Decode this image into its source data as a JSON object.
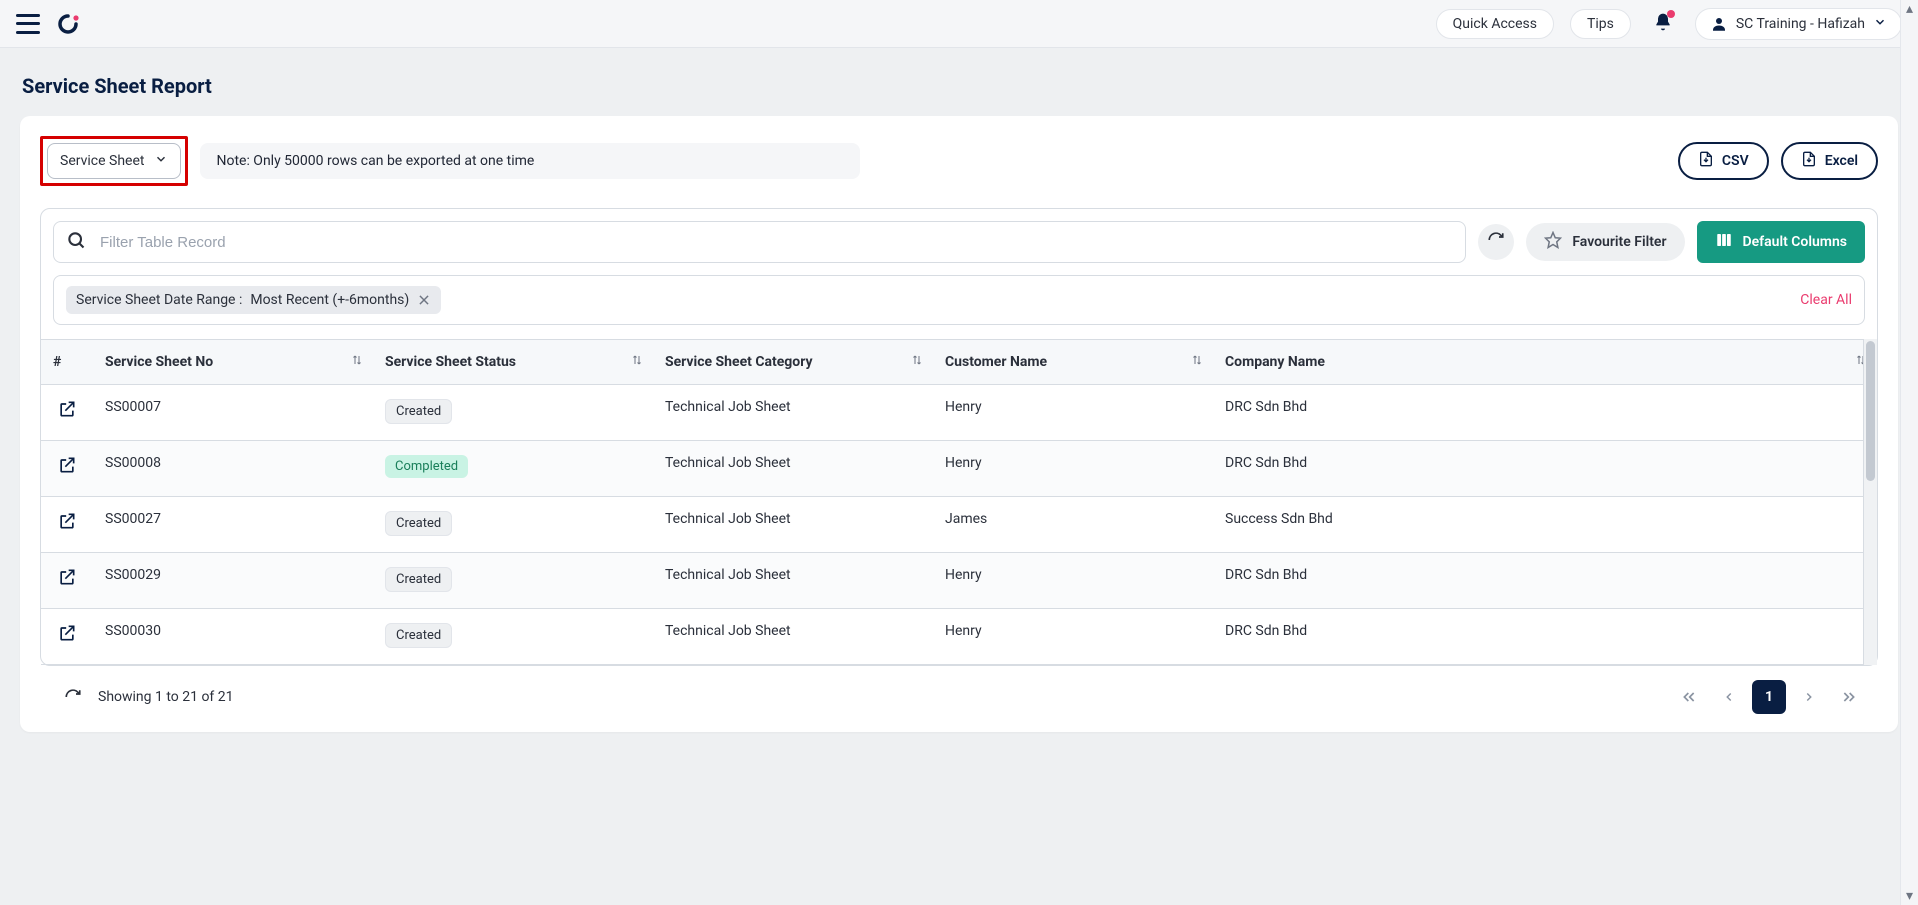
{
  "header": {
    "quick_access": "Quick Access",
    "tips": "Tips",
    "user_label": "SC Training - Hafizah"
  },
  "page": {
    "title": "Service Sheet Report"
  },
  "controls": {
    "select_label": "Service Sheet",
    "note": "Note: Only 50000 rows can be exported at one time",
    "csv_label": "CSV",
    "excel_label": "Excel",
    "search_placeholder": "Filter Table Record",
    "favourite_label": "Favourite Filter",
    "default_columns_label": "Default Columns",
    "clear_all": "Clear All"
  },
  "active_filter": {
    "label": "Service Sheet Date Range :",
    "value": "Most Recent (+-6months)"
  },
  "columns": {
    "hash": "#",
    "no": "Service Sheet No",
    "status": "Service Sheet Status",
    "category": "Service Sheet Category",
    "customer": "Customer Name",
    "company": "Company Name"
  },
  "rows": [
    {
      "no": "SS00007",
      "status": "Created",
      "status_kind": "created",
      "category": "Technical Job Sheet",
      "customer": "Henry",
      "company": "DRC Sdn Bhd"
    },
    {
      "no": "SS00008",
      "status": "Completed",
      "status_kind": "completed",
      "category": "Technical Job Sheet",
      "customer": "Henry",
      "company": "DRC Sdn Bhd"
    },
    {
      "no": "SS00027",
      "status": "Created",
      "status_kind": "created",
      "category": "Technical Job Sheet",
      "customer": "James",
      "company": "Success Sdn Bhd"
    },
    {
      "no": "SS00029",
      "status": "Created",
      "status_kind": "created",
      "category": "Technical Job Sheet",
      "customer": "Henry",
      "company": "DRC Sdn Bhd"
    },
    {
      "no": "SS00030",
      "status": "Created",
      "status_kind": "created",
      "category": "Technical Job Sheet",
      "customer": "Henry",
      "company": "DRC Sdn Bhd"
    }
  ],
  "footer": {
    "showing": "Showing 1 to 21 of 21",
    "page": "1"
  }
}
